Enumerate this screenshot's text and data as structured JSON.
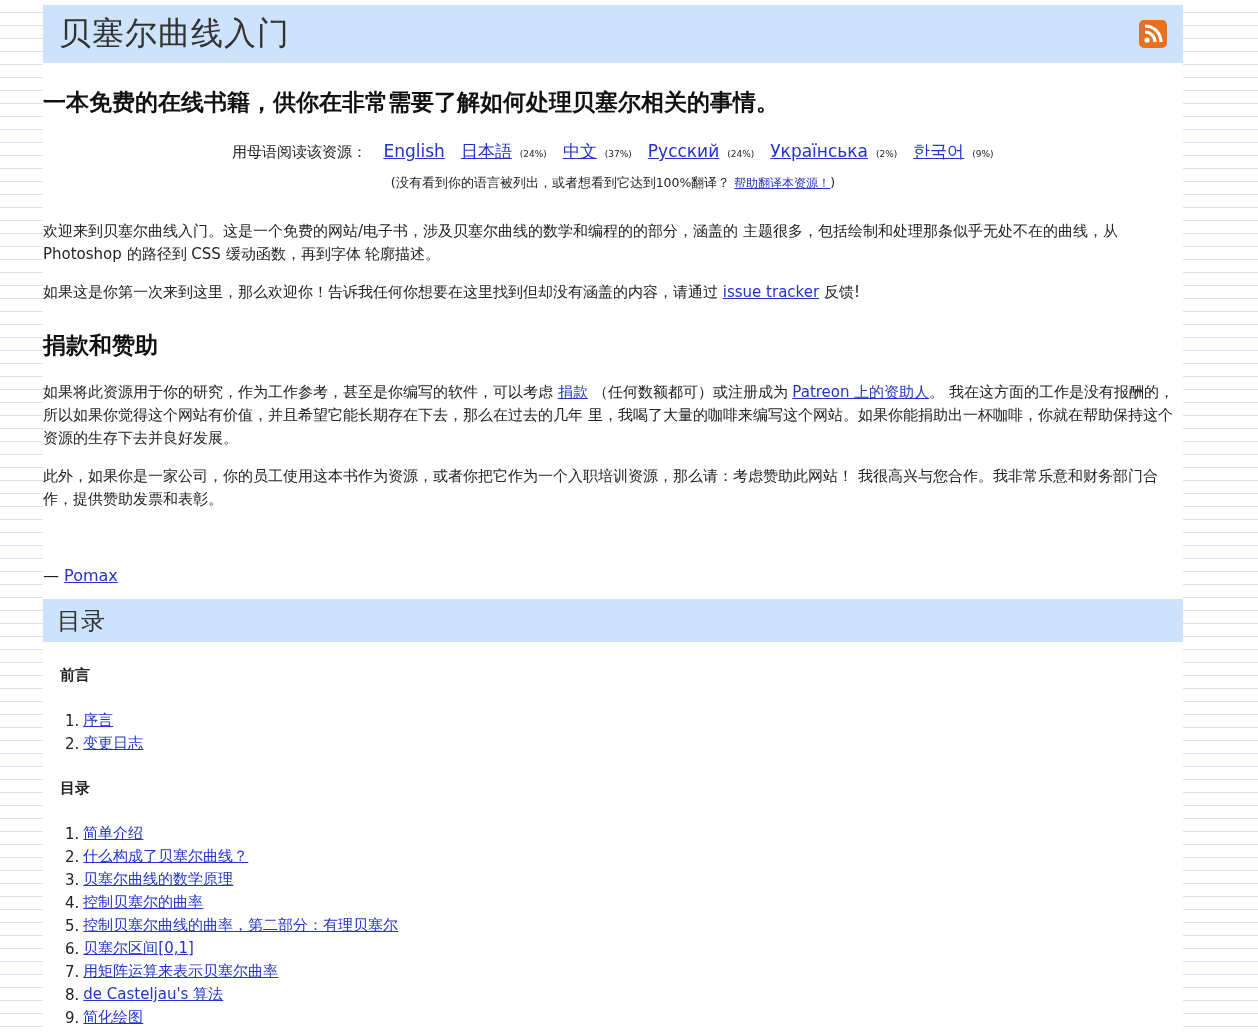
{
  "header": {
    "title": "贝塞尔曲线入门"
  },
  "subtitle": "一本免费的在线书籍，供你在非常需要了解如何处理贝塞尔相关的事情。",
  "languages": {
    "label": "用母语阅读该资源：",
    "items": [
      {
        "name": "English"
      },
      {
        "name": "日本語",
        "percent": "(24%)"
      },
      {
        "name": "中文",
        "percent": "(37%)"
      },
      {
        "name": "Русский",
        "percent": "(24%)"
      },
      {
        "name": "Українська",
        "percent": "(2%)"
      },
      {
        "name": "한국어",
        "percent": "(9%)"
      }
    ],
    "note": {
      "text": "(没有看到你的语言被列出，或者想看到它达到100%翻译？",
      "link": "帮助翻译本资源！",
      "close": ")"
    }
  },
  "intro": [
    [
      {
        "kind": "text",
        "text": "欢迎来到贝塞尔曲线入门。这是一个免费的网站/电子书，涉及贝塞尔曲线的数学和编程的的部分，涵盖的 主题很多，包括绘制和处理那条似乎无处不在的曲线，从 Photoshop 的路径到 CSS 缓动函数，再到字体 轮廓描述。"
      }
    ],
    [
      {
        "kind": "text",
        "text": "如果这是你第一次来到这里，那么欢迎你！告诉我任何你想要在这里找到但却没有涵盖的内容，请通过 "
      },
      {
        "kind": "link",
        "text": "issue tracker"
      },
      {
        "kind": "text",
        "text": " 反馈!"
      }
    ]
  ],
  "donate": {
    "heading": "捐款和赞助",
    "paragraphs": [
      [
        {
          "kind": "text",
          "text": "如果将此资源用于你的研究，作为工作参考，甚至是你编写的软件，可以考虑 "
        },
        {
          "kind": "link",
          "text": "捐款"
        },
        {
          "kind": "text",
          "text": " （任何数额都可）或注册成为 "
        },
        {
          "kind": "link",
          "text": "Patreon 上的资助人"
        },
        {
          "kind": "text",
          "text": "。 我在这方面的工作是没有报酬的，所以如果你觉得这个网站有价值，并且希望它能长期存在下去，那么在过去的几年 里，我喝了大量的咖啡来编写这个网站。如果你能捐助出一杯咖啡，你就在帮助保持这个资源的生存下去并良好发展。"
        }
      ],
      [
        {
          "kind": "text",
          "text": "此外，如果你是一家公司，你的员工使用这本书作为资源，或者你把它作为一个入职培训资源，那么请：考虑赞助此网站！ 我很高兴与您合作。我非常乐意和财务部门合作，提供赞助发票和表彰。"
        }
      ]
    ]
  },
  "signature": {
    "dash": "—",
    "author": "Pomax"
  },
  "toc": {
    "title": "目录",
    "sections": [
      {
        "heading": "前言",
        "items": [
          {
            "number": "1.",
            "title": "序言"
          },
          {
            "number": "2.",
            "title": "变更日志"
          }
        ]
      },
      {
        "heading": "目录",
        "items": [
          {
            "number": "1.",
            "title": "简单介绍"
          },
          {
            "number": "2.",
            "title": "什么构成了贝塞尔曲线？"
          },
          {
            "number": "3.",
            "title": "贝塞尔曲线的数学原理"
          },
          {
            "number": "4.",
            "title": "控制贝塞尔的曲率"
          },
          {
            "number": "5.",
            "title": "控制贝塞尔曲线的曲率，第二部分：有理贝塞尔"
          },
          {
            "number": "6.",
            "title": "贝塞尔区间[0,1]"
          },
          {
            "number": "7.",
            "title": "用矩阵运算来表示贝塞尔曲率"
          },
          {
            "number": "8.",
            "title": "de Casteljau's 算法"
          },
          {
            "number": "9.",
            "title": "简化绘图"
          }
        ]
      }
    ]
  }
}
